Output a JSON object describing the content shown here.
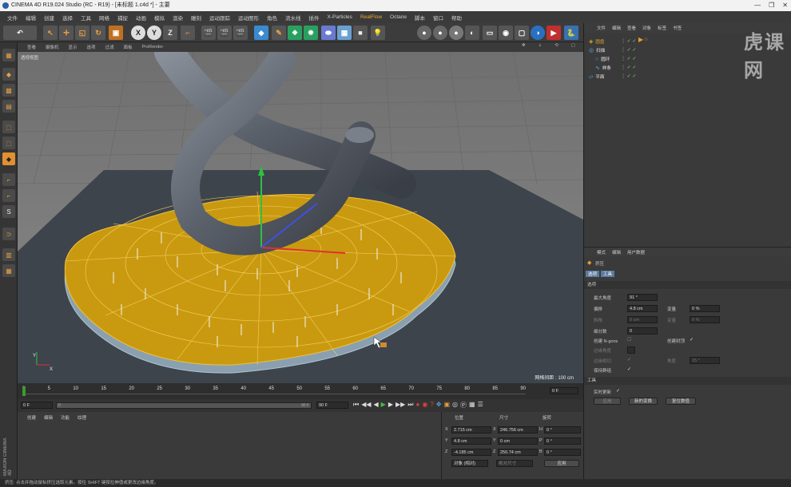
{
  "window": {
    "title": "CINEMA 4D R19.024 Studio (RC - R19) - [未标题 1.c4d *] - 主要",
    "controls": [
      "—",
      "❐",
      "✕"
    ]
  },
  "menubar": {
    "items": [
      "文件",
      "编辑",
      "创建",
      "选择",
      "工具",
      "网格",
      "捕捉",
      "动画",
      "模拟",
      "渲染",
      "雕刻",
      "运动跟踪",
      "运动图形",
      "角色",
      "流水线",
      "插件",
      "X-Particles",
      "RealFlow",
      "Octane",
      "脚本",
      "窗口",
      "帮助"
    ]
  },
  "viewport": {
    "menu": [
      "查看",
      "摄像机",
      "显示",
      "选项",
      "过滤",
      "面板",
      "ProRender"
    ],
    "label": "透视视图",
    "grid_info": "网格间距 : 100 cm"
  },
  "timeline": {
    "ticks": [
      "0",
      "5",
      "10",
      "15",
      "20",
      "25",
      "30",
      "35",
      "40",
      "45",
      "50",
      "55",
      "60",
      "65",
      "70",
      "75",
      "80",
      "85",
      "90"
    ],
    "current_frame": "0 F",
    "start_field": "0 F",
    "end_field": "90 F",
    "range_end": "90 F",
    "range_start": "0"
  },
  "material_panel": {
    "menu": [
      "创建",
      "编辑",
      "功能",
      "纹理"
    ],
    "brand": "MAXON CINEMA 4D"
  },
  "coord_panel": {
    "headers": [
      "位置",
      "尺寸",
      "旋转"
    ],
    "rows": [
      {
        "axis1": "X",
        "pos": "2.715 cm",
        "axis2": "X",
        "size": "246.756 cm",
        "axis3": "H",
        "rot": "0 °"
      },
      {
        "axis1": "Y",
        "pos": "4.8 cm",
        "axis2": "Y",
        "size": "0 cm",
        "axis3": "P",
        "rot": "0 °"
      },
      {
        "axis1": "Z",
        "pos": "-4.185 cm",
        "axis2": "Z",
        "size": "250.74 cm",
        "axis3": "B",
        "rot": "0 °"
      }
    ],
    "mode_select": "对象 (相对)",
    "size_select": "绝对尺寸",
    "apply_label": "应用"
  },
  "object_manager": {
    "menu": [
      "文件",
      "编辑",
      "查看",
      "对象",
      "标签",
      "书签"
    ],
    "objects": [
      {
        "name": "圆盘",
        "color": "#e0a030"
      },
      {
        "name": "扫描",
        "color": "#5ab0e0"
      },
      {
        "name": "圆环",
        "color": "#5ab0e0"
      },
      {
        "name": "样条",
        "color": "#5ab0e0"
      },
      {
        "name": "平面",
        "color": "#5ab0e0"
      }
    ]
  },
  "attribute_manager": {
    "menu": [
      "模式",
      "编辑",
      "用户数据"
    ],
    "tool_name": "挤压",
    "tabs": [
      "选项",
      "工具"
    ],
    "section_options": "选项",
    "fields": [
      {
        "label": "最大角度",
        "value": "91 °"
      },
      {
        "label": "偏移",
        "value": "4.8 cm"
      },
      {
        "label": "斜角",
        "value": "0 cm"
      },
      {
        "label": "细分数",
        "value": "0"
      }
    ],
    "right_fields": [
      {
        "label": "变量",
        "value": "0 %"
      },
      {
        "label": "变量",
        "value": "0 %"
      }
    ],
    "checks": [
      {
        "label": "创建 N-gons"
      },
      {
        "label": "边缘角度"
      },
      {
        "label": "边缘相切"
      },
      {
        "label": "保持群组"
      }
    ],
    "create_cap_label": "创建封顶",
    "angle_label": "角度",
    "angle_value": "15 °",
    "section_tool": "工具",
    "realtime_label": "实时更新",
    "buttons": [
      "应用",
      "新的变换",
      "复位数值"
    ]
  },
  "statusbar": {
    "text": "挤压: 点击并拖动鼠标挤压选取元素。按住 SHIFT 键按拉伸值或更改边缘角度。"
  },
  "watermark": "虎课网"
}
